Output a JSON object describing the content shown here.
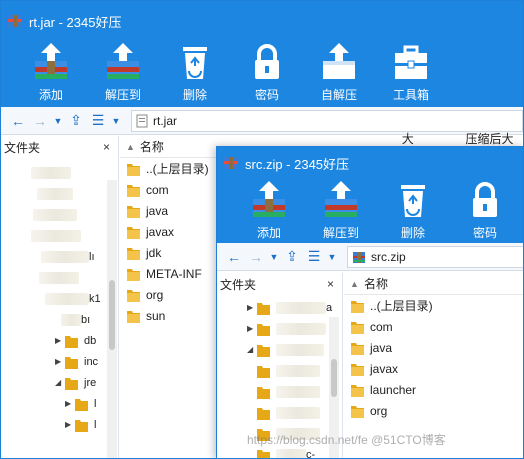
{
  "back_window": {
    "title": "rt.jar - 2345好压",
    "toolbar": [
      "添加",
      "解压到",
      "删除",
      "密码",
      "自解压",
      "工具箱"
    ],
    "address": "rt.jar",
    "sidebar_title": "文件夹",
    "sidebar_close": "×",
    "col_name": "名称",
    "col_size_partial": "大小",
    "col_compressed_partial": "压缩后大小",
    "items": [
      "..(上层目录)",
      "com",
      "java",
      "javax",
      "jdk",
      "META-INF",
      "org",
      "sun"
    ],
    "tree_fragments": [
      "lı",
      "k1",
      "bı",
      "db",
      "inc",
      "jre",
      "l",
      "l"
    ]
  },
  "front_window": {
    "title": "src.zip - 2345好压",
    "toolbar": [
      "添加",
      "解压到",
      "删除",
      "密码"
    ],
    "address": "src.zip",
    "sidebar_title": "文件夹",
    "sidebar_close": "×",
    "col_name": "名称",
    "items": [
      "..(上层目录)",
      "com",
      "java",
      "javax",
      "launcher",
      "org"
    ],
    "tree_fragments": [
      "a",
      "c-"
    ]
  },
  "watermark": "https://blog.csdn.net/fe @51CTO博客",
  "colors": {
    "title_bar": "#1c86e0",
    "folder": "#e6a817",
    "accent": "#1c6fc7"
  }
}
